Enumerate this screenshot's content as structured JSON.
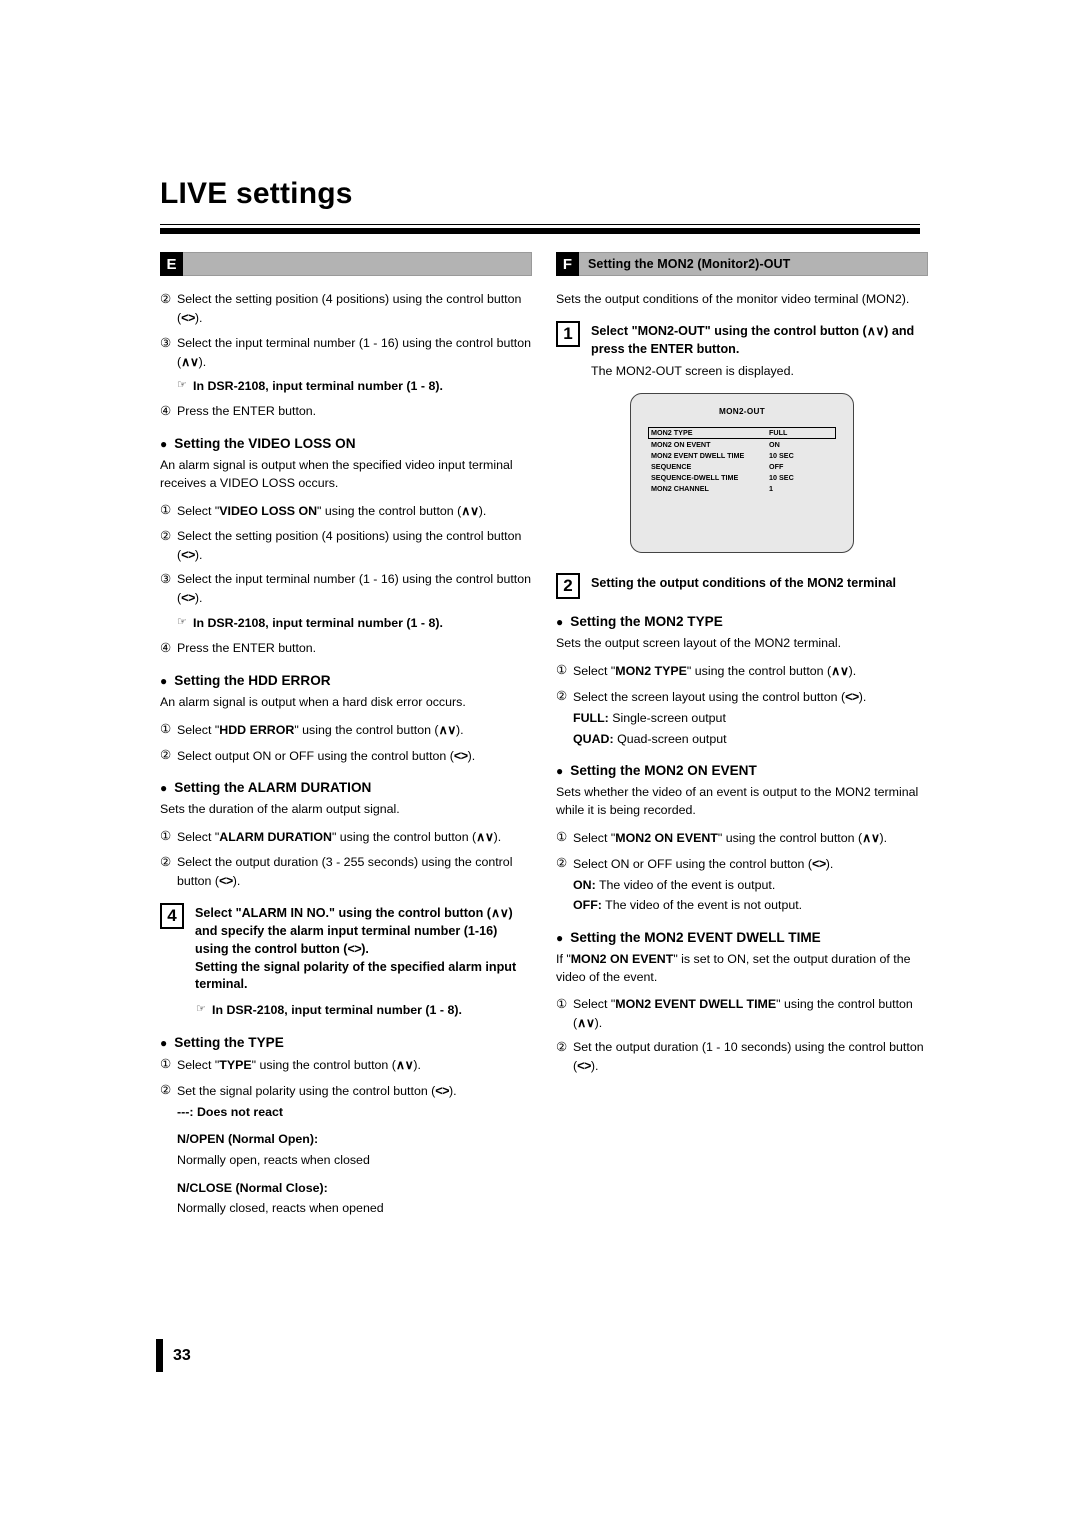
{
  "document": {
    "title": "LIVE settings",
    "page_number": "33"
  },
  "sections": {
    "E": {
      "letter": "E",
      "title": ""
    },
    "F": {
      "letter": "F",
      "title": "Setting the MON2 (Monitor2)-OUT"
    }
  },
  "left_column": {
    "continued_steps": [
      {
        "num": "②",
        "text_html": "Select the setting position (4 positions) using the control button (<span class=\"ctrl\">&lt;&gt;</span>)."
      },
      {
        "num": "③",
        "text_html": "Select the input terminal number (1 - 16) using the control button (<span class=\"ctrl\">∧∨</span>)."
      }
    ],
    "note_dsr2108": "In DSR-2108, input terminal number (1 - 8).",
    "step_enter": {
      "num": "④",
      "text": "Press the ENTER button."
    },
    "video_loss": {
      "heading": "Setting the VIDEO LOSS ON",
      "intro": "An alarm signal is output when the specified video input terminal receives a VIDEO LOSS occurs.",
      "steps": [
        {
          "num": "①",
          "text_html": "Select \"<b>VIDEO LOSS ON</b>\" using the control button (<span class=\"ctrl\">∧∨</span>)."
        },
        {
          "num": "②",
          "text_html": "Select the setting position (4 positions) using the control button (<span class=\"ctrl\">&lt;&gt;</span>)."
        },
        {
          "num": "③",
          "text_html": "Select the input terminal number (1 - 16) using the control button (<span class=\"ctrl\">&lt;&gt;</span>)."
        }
      ],
      "note": "In DSR-2108, input terminal number (1 - 8).",
      "final_step": {
        "num": "④",
        "text": "Press the ENTER button."
      }
    },
    "hdd_error": {
      "heading": "Setting the HDD ERROR",
      "intro": "An alarm signal is output when a hard disk error occurs.",
      "steps": [
        {
          "num": "①",
          "text_html": "Select \"<b>HDD ERROR</b>\" using the control button (<span class=\"ctrl\">∧∨</span>)."
        },
        {
          "num": "②",
          "text_html": "Select output ON or OFF using the control button (<span class=\"ctrl\">&lt;&gt;</span>)."
        }
      ]
    },
    "alarm_duration": {
      "heading": "Setting the ALARM DURATION",
      "intro": "Sets the duration of the alarm output signal.",
      "steps": [
        {
          "num": "①",
          "text_html": "Select \"<b>ALARM DURATION</b>\" using the control button (<span class=\"ctrl\">∧∨</span>)."
        },
        {
          "num": "②",
          "text_html": "Select the output duration (3 - 255 seconds) using the control button (<span class=\"ctrl\">&lt;&gt;</span>)."
        }
      ]
    },
    "step4": {
      "number": "4",
      "text_html": "Select \"ALARM IN NO.\" using the control button (<span class=\"ctrl\">∧∨</span>) and specify the alarm input terminal number (1-16) using the control button (<span class=\"ctrl\">&lt;&gt;</span>).<br>Setting the signal polarity of the specified alarm input terminal.",
      "note": "In DSR-2108, input terminal number (1 - 8)."
    },
    "type_setting": {
      "heading": "Setting the TYPE",
      "steps": [
        {
          "num": "①",
          "text_html": "Select \"<b>TYPE</b>\" using the control button (<span class=\"ctrl\">∧∨</span>)."
        },
        {
          "num": "②",
          "text_html": "Set the signal polarity using the control button (<span class=\"ctrl\">&lt;&gt;</span>)."
        }
      ],
      "no_react": "---: Does not react",
      "n_open_label": "N/OPEN (Normal Open):",
      "n_open_desc": "Normally open, reacts when closed",
      "n_close_label": "N/CLOSE (Normal Close):",
      "n_close_desc": "Normally closed, reacts when opened"
    }
  },
  "right_column": {
    "intro": "Sets the output conditions of the monitor video terminal (MON2).",
    "step1": {
      "number": "1",
      "text_html": "Select \"MON2-OUT\" using the control button (<span class=\"ctrl\">∧∨</span>) and press the ENTER button.",
      "sub": "The MON2-OUT screen is displayed."
    },
    "osd": {
      "title": "MON2-OUT",
      "rows": [
        {
          "label": "MON2 TYPE",
          "value": "FULL",
          "selected": true
        },
        {
          "label": "MON2 ON EVENT",
          "value": "ON",
          "selected": false
        },
        {
          "label": "MON2 EVENT DWELL TIME",
          "value": "10 SEC",
          "selected": false
        },
        {
          "label": "SEQUENCE",
          "value": "OFF",
          "selected": false
        },
        {
          "label": "SEQUENCE-DWELL TIME",
          "value": "10 SEC",
          "selected": false
        },
        {
          "label": "MON2 CHANNEL",
          "value": "1",
          "selected": false
        }
      ]
    },
    "step2": {
      "number": "2",
      "text": "Setting the output conditions of the MON2 terminal"
    },
    "mon2_type": {
      "heading": "Setting the MON2 TYPE",
      "intro": "Sets the output screen layout of the MON2 terminal.",
      "steps": [
        {
          "num": "①",
          "text_html": "Select \"<b>MON2 TYPE</b>\" using the control button (<span class=\"ctrl\">∧∨</span>)."
        },
        {
          "num": "②",
          "text_html": "Select the screen layout using the control button (<span class=\"ctrl\">&lt;&gt;</span>)."
        }
      ],
      "full_label": "FULL:",
      "full_desc": "Single-screen output",
      "quad_label": "QUAD:",
      "quad_desc": "Quad-screen output"
    },
    "mon2_on_event": {
      "heading": "Setting the MON2 ON EVENT",
      "intro": "Sets whether the video of an event is output to the MON2 terminal while it is being recorded.",
      "steps": [
        {
          "num": "①",
          "text_html": "Select \"<b>MON2 ON EVENT</b>\" using the control button (<span class=\"ctrl\">∧∨</span>)."
        },
        {
          "num": "②",
          "text_html": "Select ON or OFF using the control button (<span class=\"ctrl\">&lt;&gt;</span>)."
        }
      ],
      "on_label": "ON:",
      "on_desc": "The video of the event is output.",
      "off_label": "OFF:",
      "off_desc": "The video of the event is not output."
    },
    "mon2_event_dwell": {
      "heading": "Setting the MON2 EVENT DWELL TIME",
      "intro_html": "If \"<b>MON2 ON EVENT</b>\" is set to ON, set the output duration of the video of the event.",
      "steps": [
        {
          "num": "①",
          "text_html": "Select \"<b>MON2 EVENT DWELL TIME</b>\" using the control button (<span class=\"ctrl\">∧∨</span>)."
        },
        {
          "num": "②",
          "text_html": "Set the output duration (1 - 10 seconds) using the control button (<span class=\"ctrl\">&lt;&gt;</span>)."
        }
      ]
    }
  },
  "icons": {
    "pointing_hand": "☞",
    "bullet": "●"
  }
}
